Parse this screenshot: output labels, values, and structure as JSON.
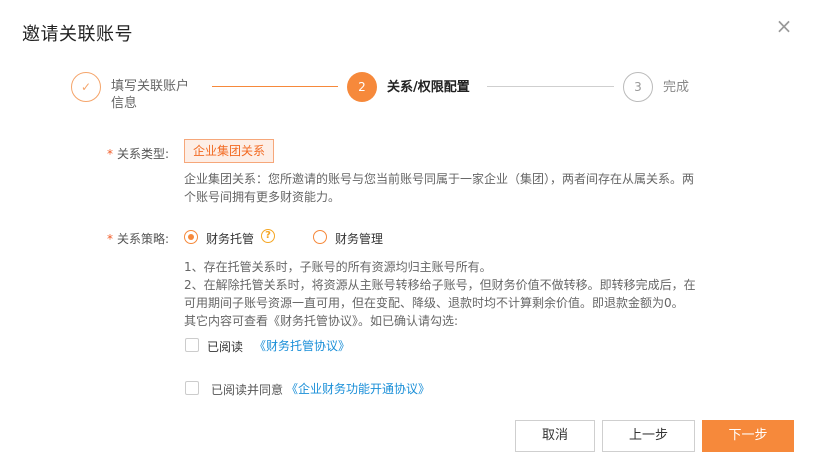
{
  "dialog": {
    "title": "邀请关联账号",
    "close_icon": "×"
  },
  "steps": [
    {
      "index": "✓",
      "label_line1": "填写关联账户",
      "label_line2": "信息",
      "state": "done"
    },
    {
      "index": "2",
      "label_line1": "关系/权限配置",
      "state": "active"
    },
    {
      "index": "3",
      "label_line1": "完成",
      "state": "pending"
    }
  ],
  "relation_type": {
    "required_mark": "*",
    "label": "关系类型:",
    "value": "企业集团关系",
    "desc_line1": "企业集团关系：您所邀请的账号与您当前账号同属于一家企业（集团），两者间存在从属关系。两",
    "desc_line2": "个账号间拥有更多财资能力。"
  },
  "relation_strategy": {
    "required_mark": "*",
    "label": "关系策略:",
    "options": [
      {
        "label": "财务托管",
        "selected": true
      },
      {
        "label": "财务管理",
        "selected": false
      }
    ],
    "help_icon": "?",
    "desc_line1": "1、存在托管关系时，子账号的所有资源均归主账号所有。",
    "desc_line2": "2、在解除托管关系时，将资源从主账号转移给子账号，但财务价值不做转移。即转移完成后，在",
    "desc_line3": "可用期间子账号资源一直可用，但在变配、降级、退款时均不计算剩余价值。即退款金额为0。",
    "desc_line4": "其它内容可查看《财务托管协议》。如已确认请勾选:",
    "check_label": "已阅读",
    "check_link": "《财务托管协议》"
  },
  "agreement": {
    "label": "已阅读并同意",
    "link": "《企业财务功能开通协议》"
  },
  "footer": {
    "cancel": "取消",
    "prev": "上一步",
    "next": "下一步"
  },
  "colors": {
    "accent": "#f6893b",
    "link": "#1a8fd8",
    "required": "#f25c28"
  }
}
